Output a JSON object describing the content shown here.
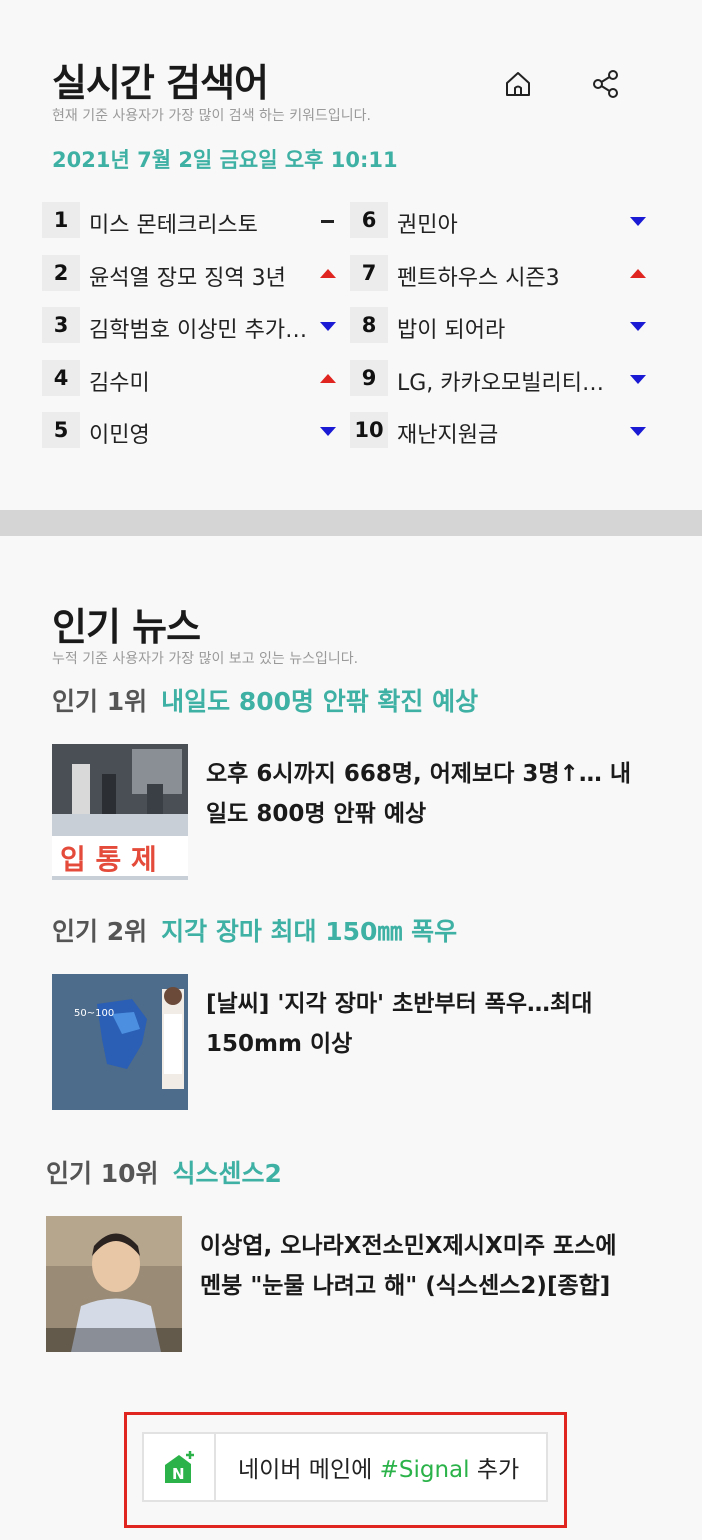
{
  "realtime": {
    "title": "실시간 검색어",
    "subtitle": "현재 기준 사용자가 가장 많이 검색 하는 키워드입니다.",
    "datetime": "2021년 7월 2일 금요일 오후 10:11",
    "left_items": [
      {
        "rank": "1",
        "keyword": "미스 몬테크리스토",
        "trend": "same"
      },
      {
        "rank": "2",
        "keyword": "윤석열 장모 징역 3년",
        "trend": "up"
      },
      {
        "rank": "3",
        "keyword": "김학범호 이상민 추가 발탁",
        "trend": "down"
      },
      {
        "rank": "4",
        "keyword": "김수미",
        "trend": "up"
      },
      {
        "rank": "5",
        "keyword": "이민영",
        "trend": "down"
      }
    ],
    "right_items": [
      {
        "rank": "6",
        "keyword": "권민아",
        "trend": "down"
      },
      {
        "rank": "7",
        "keyword": "펜트하우스 시즌3",
        "trend": "up"
      },
      {
        "rank": "8",
        "keyword": "밥이 되어라",
        "trend": "down"
      },
      {
        "rank": "9",
        "keyword": "LG, 카카오모빌리티에 투자",
        "trend": "down"
      },
      {
        "rank": "10",
        "keyword": "재난지원금",
        "trend": "down"
      }
    ],
    "icons": {
      "home": "home-icon",
      "share": "share-icon"
    }
  },
  "news": {
    "title": "인기 뉴스",
    "subtitle": "누적 기준 사용자가 가장 많이 보고 있는 뉴스입니다.",
    "items": [
      {
        "rank": "인기 1위",
        "keyword": "내일도 800명 안팎 확진 예상",
        "headline": "오후 6시까지 668명, 어제보다 3명↑… 내일도 800명 안팎 예상",
        "thumb_text": "입 통 제"
      },
      {
        "rank": "인기 2위",
        "keyword": "지각 장마 최대 150㎜ 폭우",
        "headline": "[날씨] '지각 장마' 초반부터 폭우…최대 150mm 이상",
        "thumb_text": "50~100"
      },
      {
        "rank": "인기 10위",
        "keyword": "식스센스2",
        "headline": "이상엽, 오나라X전소민X제시X미주 포스에 멘붕 \"눈물 나려고 해\" (식스센스2)[종합]",
        "thumb_text": ""
      }
    ]
  },
  "cta": {
    "prefix": "네이버 메인에 ",
    "highlight": "#Signal",
    "suffix": " 추가",
    "colors": {
      "accent": "#2bb34a",
      "frame": "#e0241f"
    }
  },
  "colors": {
    "teal": "#3fb0a4",
    "up": "#e0241f",
    "down": "#1a1ad4"
  }
}
